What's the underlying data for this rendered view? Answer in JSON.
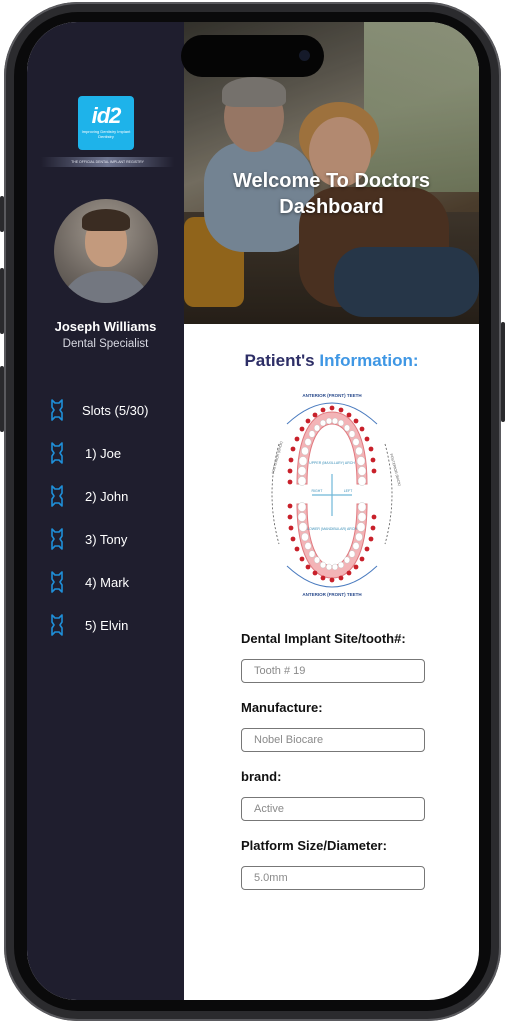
{
  "logo": {
    "mark": "id2",
    "tagline": "Improving Dentistry Implant Dentistry",
    "strip": "THE OFFICIAL DENTAL IMPLANT REGISTRY"
  },
  "profile": {
    "name": "Joseph Williams",
    "role": "Dental Specialist"
  },
  "sidebar": {
    "items": [
      {
        "label": "Slots (5/30)",
        "icon": "tooth-icon"
      },
      {
        "label": "1) Joe",
        "icon": "tooth-icon"
      },
      {
        "label": "2) John",
        "icon": "tooth-icon"
      },
      {
        "label": "3) Tony",
        "icon": "tooth-icon"
      },
      {
        "label": "4) Mark",
        "icon": "tooth-icon"
      },
      {
        "label": "5) Elvin",
        "icon": "tooth-icon"
      }
    ]
  },
  "hero": {
    "title": "Welcome To Doctors Dashboard"
  },
  "patient": {
    "title_a": "Patient's",
    "title_b": "Information:"
  },
  "chart": {
    "top_label": "ANTERIOR (FRONT) TEETH",
    "bottom_label": "ANTERIOR (FRONT) TEETH",
    "upper_arch": "UPPER (MAXILLARY) ARCH",
    "lower_arch": "LOWER (MANDIBULAR) ARCH",
    "right": "RIGHT",
    "left": "LEFT",
    "posterior_left": "POSTERIOR (BACK)",
    "posterior_right": "POSTERIOR (BACK)"
  },
  "form": {
    "site_label": "Dental Implant Site/tooth#:",
    "site_placeholder": "Tooth # 19",
    "manufacture_label": "Manufacture:",
    "manufacture_placeholder": "Nobel Biocare",
    "brand_label": "brand:",
    "brand_placeholder": "Active",
    "platform_label": "Platform Size/Diameter:",
    "platform_placeholder": "5.0mm"
  },
  "colors": {
    "sidebar": "#1f1e2e",
    "accent": "#3f97e4",
    "title_dark": "#2d2e66",
    "tooth_red": "#c8202a"
  }
}
